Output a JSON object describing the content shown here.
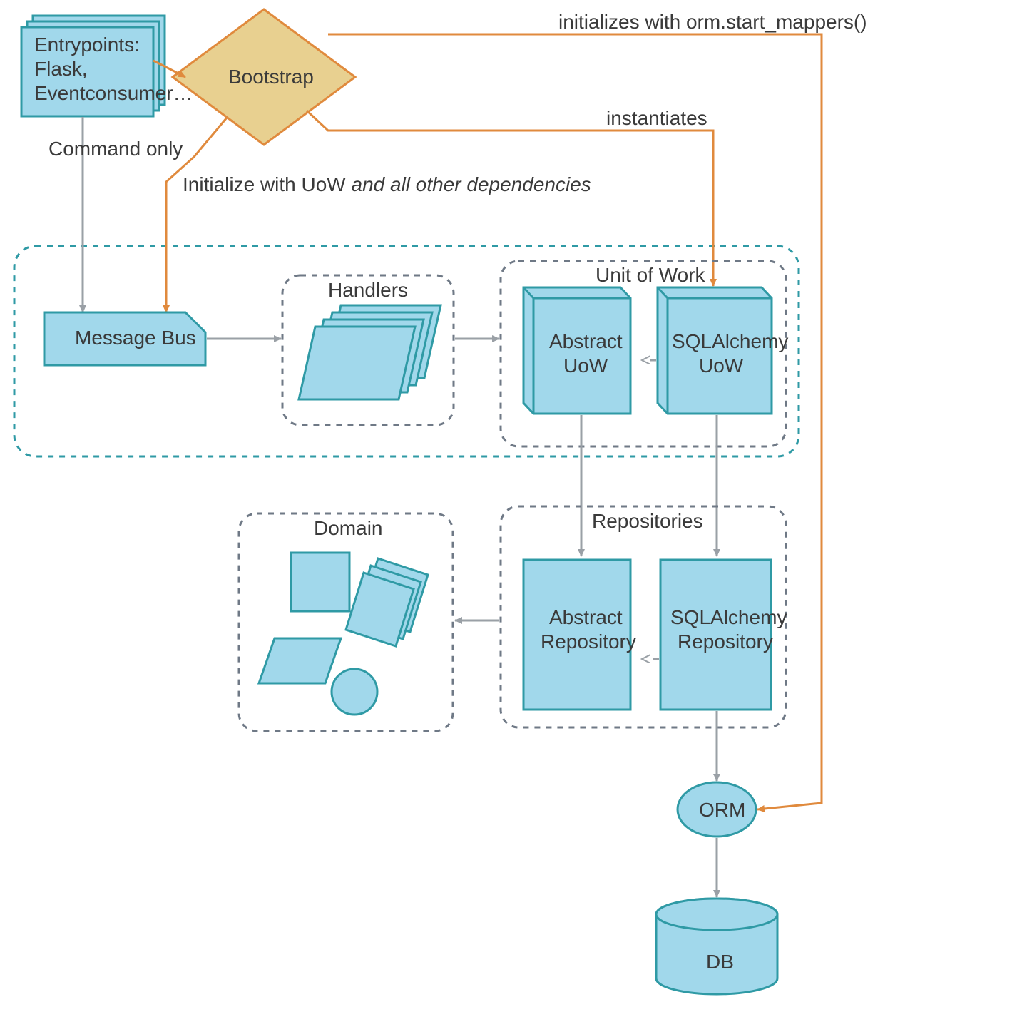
{
  "nodes": {
    "entrypoints": {
      "line1": "Entrypoints:",
      "line2": "Flask,",
      "line3": "Eventconsumer…"
    },
    "bootstrap": "Bootstrap",
    "messageBus": "Message Bus",
    "handlersTitle": "Handlers",
    "uowTitle": "Unit of Work",
    "abstractUow": {
      "line1": "Abstract",
      "line2": "UoW"
    },
    "sqlalchemyUow": {
      "line1": "SQLAlchemy",
      "line2": "UoW"
    },
    "reposTitle": "Repositories",
    "abstractRepo": {
      "line1": "Abstract",
      "line2": "Repository"
    },
    "sqlalchemyRepo": {
      "line1": "SQLAlchemy",
      "line2": "Repository"
    },
    "domainTitle": "Domain",
    "orm": "ORM",
    "db": "DB"
  },
  "edgeLabels": {
    "commandOnly": "Command only",
    "initializeDeps": {
      "prefix": "Initialize with UoW ",
      "italic": "and all other dependencies"
    },
    "instantiates": "instantiates",
    "initializesOrm": "initializes with orm.start_mappers()"
  }
}
